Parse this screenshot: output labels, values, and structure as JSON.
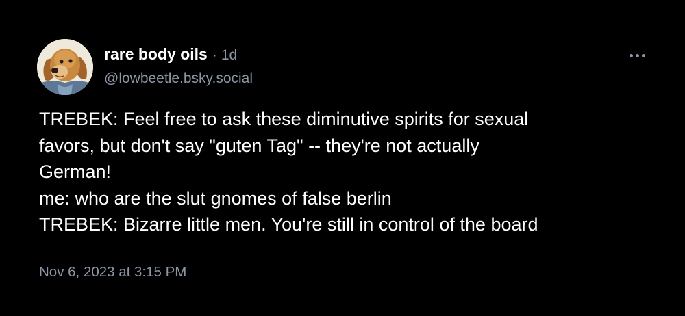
{
  "post": {
    "author": {
      "display_name": "rare body oils",
      "separator": "·",
      "age": "1d",
      "handle": "@lowbeetle.bsky.social",
      "avatar_icon": "dog-avatar-icon"
    },
    "more_icon": "ellipsis-icon",
    "text_lines": [
      "TREBEK: Feel free to ask these diminutive spirits for sexual",
      "favors, but don't say \"guten Tag\" -- they're not actually",
      "German!",
      "me: who are the slut gnomes of false berlin",
      "TREBEK: Bizarre little men. You're still in control of the board"
    ],
    "timestamp": "Nov 6, 2023 at 3:15 PM"
  },
  "colors": {
    "background": "#000000",
    "primary_text": "#ffffff",
    "secondary_text": "#8b95a3"
  }
}
